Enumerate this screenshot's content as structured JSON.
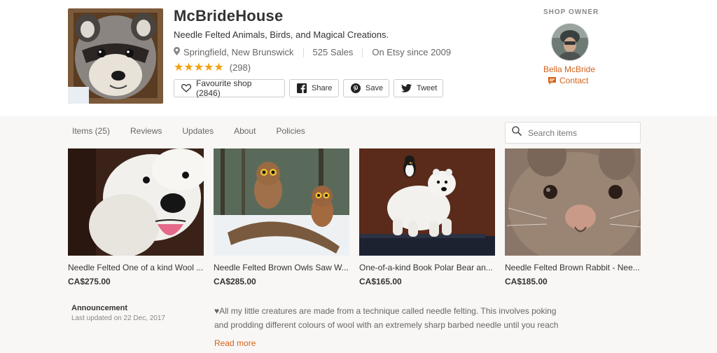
{
  "shop": {
    "name": "McBrideHouse",
    "tagline": "Needle Felted Animals, Birds, and Magical Creations.",
    "location": "Springfield, New Brunswick",
    "sales": "525 Sales",
    "since": "On Etsy since 2009",
    "rating_count": "(298)",
    "rating": 5
  },
  "actions": {
    "favourite": "Favourite shop (2846)",
    "share": "Share",
    "save": "Save",
    "tweet": "Tweet"
  },
  "owner": {
    "label": "SHOP OWNER",
    "name": "Bella McBride",
    "contact": "Contact"
  },
  "tabs": [
    "Items (25)",
    "Reviews",
    "Updates",
    "About",
    "Policies"
  ],
  "search": {
    "placeholder": "Search items"
  },
  "listings": [
    {
      "title": "Needle Felted One of a kind Wool ...",
      "price": "CA$275.00"
    },
    {
      "title": "Needle Felted Brown Owls Saw W...",
      "price": "CA$285.00"
    },
    {
      "title": "One-of-a-kind Book Polar Bear an...",
      "price": "CA$165.00"
    },
    {
      "title": "Needle Felted Brown Rabbit - Nee...",
      "price": "CA$185.00"
    }
  ],
  "announcement": {
    "title": "Announcement",
    "updated": "Last updated on 22 Dec, 2017",
    "line1": "♥All my little creatures are made from a technique called needle felting. This involves poking",
    "line2": "and prodding different colours of wool with an extremely sharp barbed needle until you reach",
    "read_more": "Read more"
  },
  "colors": {
    "accent": "#d4621a",
    "stars": "#f1a10e",
    "background": "#f8f7f5"
  }
}
